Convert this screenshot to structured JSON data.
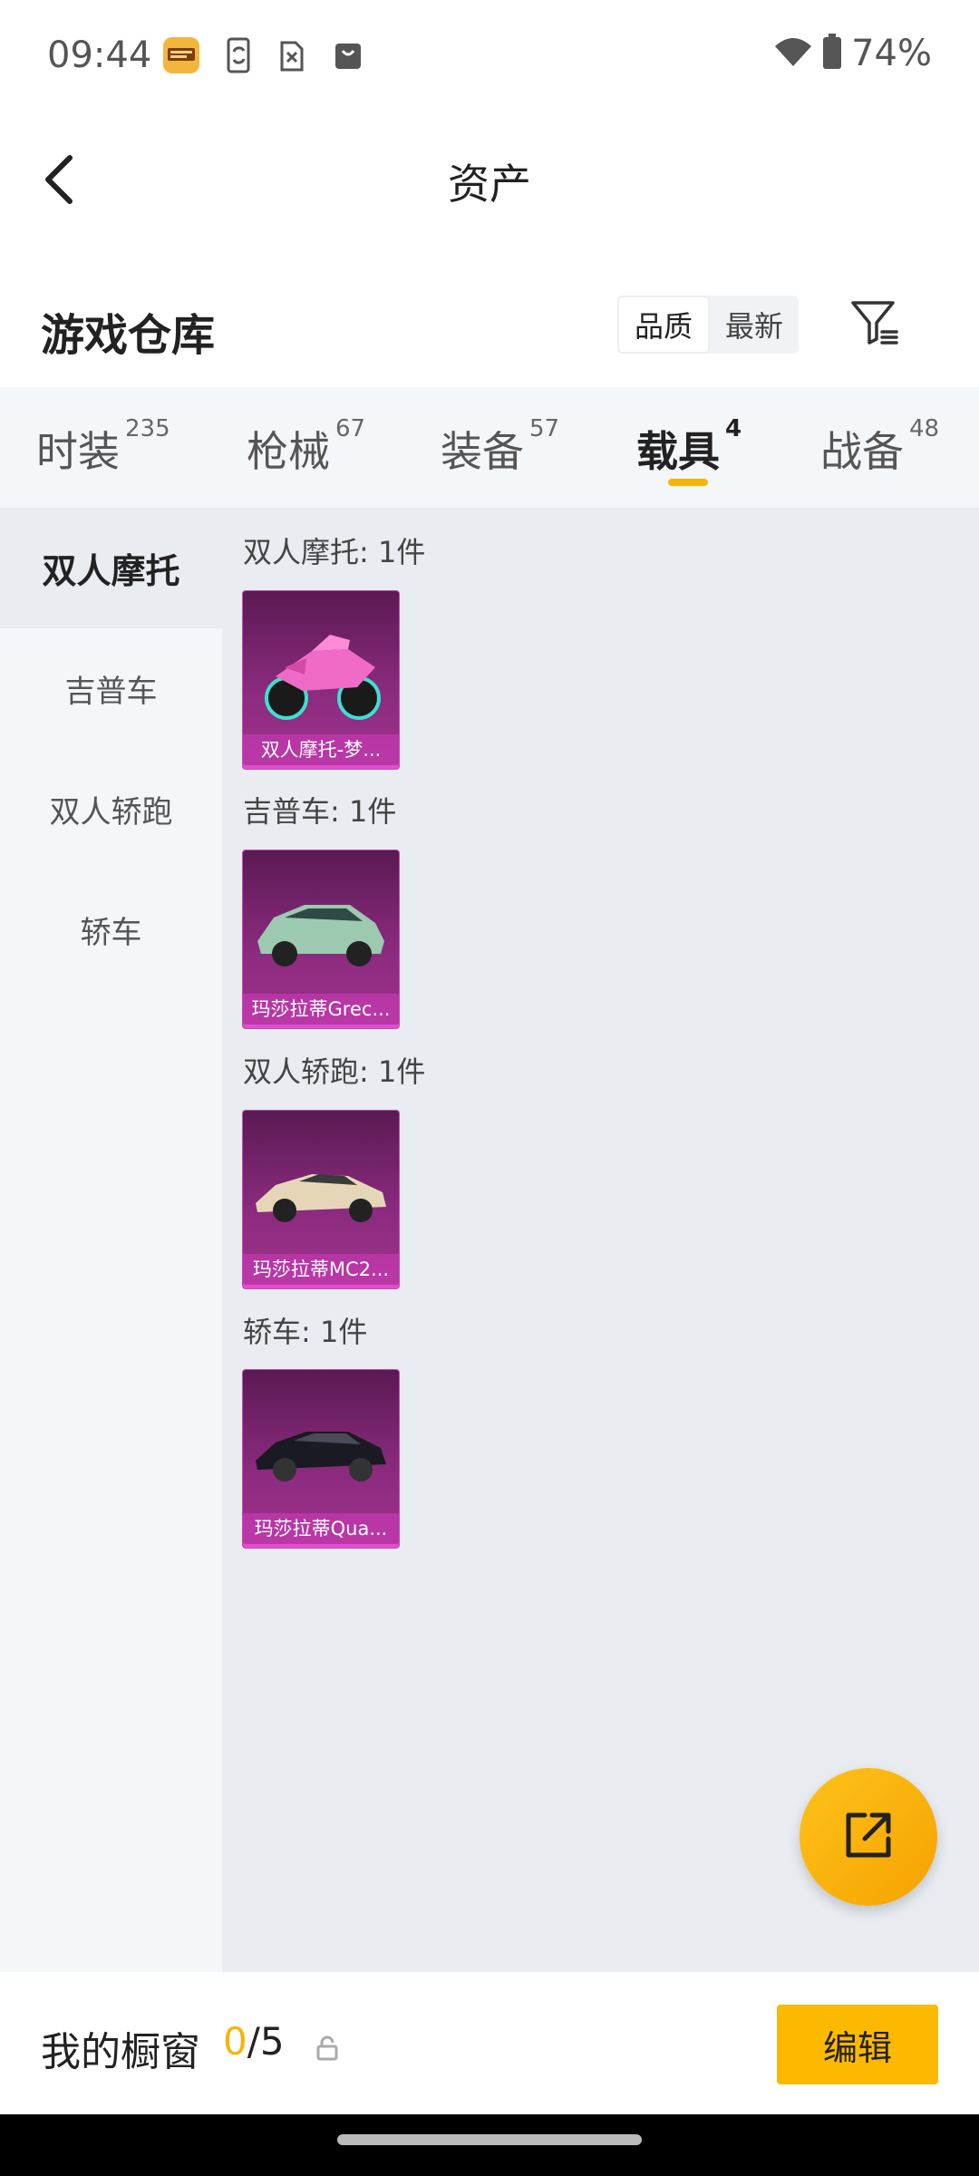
{
  "status_bar": {
    "time": "09:44",
    "battery": "74%",
    "icons": [
      "game-app-icon",
      "phone-sync-icon",
      "sim-off-icon",
      "bag-icon",
      "wifi-icon",
      "battery-icon"
    ]
  },
  "header": {
    "title": "资产",
    "back_icon": "chevron-left-icon"
  },
  "warehouse": {
    "title": "游戏仓库",
    "sort_options": [
      "品质",
      "最新"
    ],
    "active_sort": "品质",
    "filter_icon": "filter-icon"
  },
  "tabs": [
    {
      "label": "时装",
      "count": "235"
    },
    {
      "label": "枪械",
      "count": "67"
    },
    {
      "label": "装备",
      "count": "57"
    },
    {
      "label": "载具",
      "count": "4",
      "active": true
    },
    {
      "label": "战备",
      "count": "48"
    }
  ],
  "side_nav": [
    "双人摩托",
    "吉普车",
    "双人轿跑",
    "轿车"
  ],
  "sections": [
    {
      "title": "双人摩托: 1件",
      "item_label": "双人摩托-梦...",
      "image": "pink-motorcycle"
    },
    {
      "title": "吉普车: 1件",
      "item_label": "玛莎拉蒂Grec...",
      "image": "green-suv"
    },
    {
      "title": "双人轿跑: 1件",
      "item_label": "玛莎拉蒂MC2...",
      "image": "beige-sports-car"
    },
    {
      "title": "轿车: 1件",
      "item_label": "玛莎拉蒂Qua...",
      "image": "black-sedan"
    }
  ],
  "fab": {
    "icon": "share-external-icon"
  },
  "bottom_bar": {
    "title": "我的橱窗",
    "count_current": "0",
    "count_total": "/5",
    "lock_icon": "lock-icon",
    "edit_label": "编辑"
  },
  "colors": {
    "accent": "#f5b50a",
    "card": "#8a2a7e"
  }
}
